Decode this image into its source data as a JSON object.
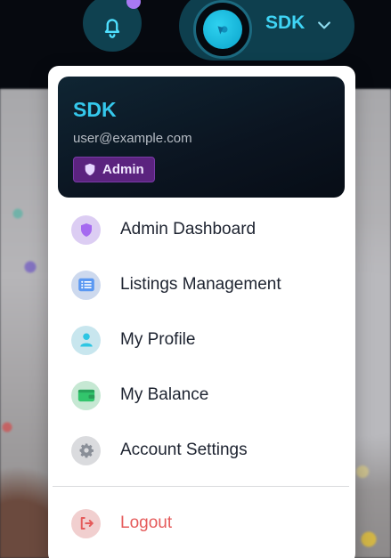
{
  "header": {
    "bell_icon": "bell-icon",
    "notification_dot_color": "#a779f3",
    "user_name": "SDK",
    "chevron_icon": "chevron-down-icon"
  },
  "menu": {
    "profile": {
      "name": "SDK",
      "email": "user@example.com",
      "role": "Admin",
      "role_icon": "shield-icon"
    },
    "items": [
      {
        "label": "Admin Dashboard",
        "icon": "shield-icon",
        "color": "#a56af0"
      },
      {
        "label": "Listings Management",
        "icon": "list-icon",
        "color": "#5a98f2"
      },
      {
        "label": "My Profile",
        "icon": "user-icon",
        "color": "#2ec6e3"
      },
      {
        "label": "My Balance",
        "icon": "wallet-icon",
        "color": "#32c56c"
      },
      {
        "label": "Account Settings",
        "icon": "gear-icon",
        "color": "#8a8f98"
      }
    ],
    "logout": {
      "label": "Logout",
      "icon": "logout-icon",
      "color": "#e55b5b"
    }
  }
}
